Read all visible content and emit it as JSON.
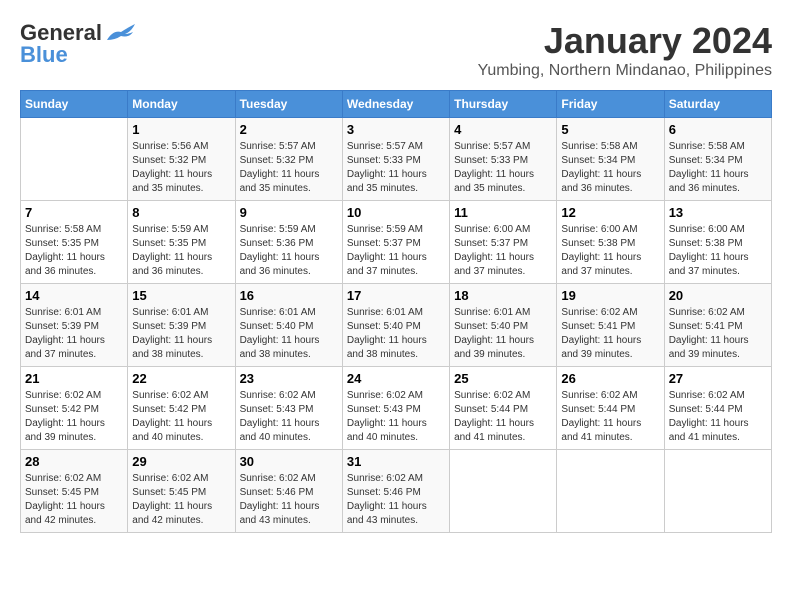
{
  "header": {
    "logo_line1": "General",
    "logo_line2": "Blue",
    "month": "January 2024",
    "location": "Yumbing, Northern Mindanao, Philippines"
  },
  "days_of_week": [
    "Sunday",
    "Monday",
    "Tuesday",
    "Wednesday",
    "Thursday",
    "Friday",
    "Saturday"
  ],
  "weeks": [
    [
      {
        "day": "",
        "sunrise": "",
        "sunset": "",
        "daylight": ""
      },
      {
        "day": "1",
        "sunrise": "Sunrise: 5:56 AM",
        "sunset": "Sunset: 5:32 PM",
        "daylight": "Daylight: 11 hours and 35 minutes."
      },
      {
        "day": "2",
        "sunrise": "Sunrise: 5:57 AM",
        "sunset": "Sunset: 5:32 PM",
        "daylight": "Daylight: 11 hours and 35 minutes."
      },
      {
        "day": "3",
        "sunrise": "Sunrise: 5:57 AM",
        "sunset": "Sunset: 5:33 PM",
        "daylight": "Daylight: 11 hours and 35 minutes."
      },
      {
        "day": "4",
        "sunrise": "Sunrise: 5:57 AM",
        "sunset": "Sunset: 5:33 PM",
        "daylight": "Daylight: 11 hours and 35 minutes."
      },
      {
        "day": "5",
        "sunrise": "Sunrise: 5:58 AM",
        "sunset": "Sunset: 5:34 PM",
        "daylight": "Daylight: 11 hours and 36 minutes."
      },
      {
        "day": "6",
        "sunrise": "Sunrise: 5:58 AM",
        "sunset": "Sunset: 5:34 PM",
        "daylight": "Daylight: 11 hours and 36 minutes."
      }
    ],
    [
      {
        "day": "7",
        "sunrise": "Sunrise: 5:58 AM",
        "sunset": "Sunset: 5:35 PM",
        "daylight": "Daylight: 11 hours and 36 minutes."
      },
      {
        "day": "8",
        "sunrise": "Sunrise: 5:59 AM",
        "sunset": "Sunset: 5:35 PM",
        "daylight": "Daylight: 11 hours and 36 minutes."
      },
      {
        "day": "9",
        "sunrise": "Sunrise: 5:59 AM",
        "sunset": "Sunset: 5:36 PM",
        "daylight": "Daylight: 11 hours and 36 minutes."
      },
      {
        "day": "10",
        "sunrise": "Sunrise: 5:59 AM",
        "sunset": "Sunset: 5:37 PM",
        "daylight": "Daylight: 11 hours and 37 minutes."
      },
      {
        "day": "11",
        "sunrise": "Sunrise: 6:00 AM",
        "sunset": "Sunset: 5:37 PM",
        "daylight": "Daylight: 11 hours and 37 minutes."
      },
      {
        "day": "12",
        "sunrise": "Sunrise: 6:00 AM",
        "sunset": "Sunset: 5:38 PM",
        "daylight": "Daylight: 11 hours and 37 minutes."
      },
      {
        "day": "13",
        "sunrise": "Sunrise: 6:00 AM",
        "sunset": "Sunset: 5:38 PM",
        "daylight": "Daylight: 11 hours and 37 minutes."
      }
    ],
    [
      {
        "day": "14",
        "sunrise": "Sunrise: 6:01 AM",
        "sunset": "Sunset: 5:39 PM",
        "daylight": "Daylight: 11 hours and 37 minutes."
      },
      {
        "day": "15",
        "sunrise": "Sunrise: 6:01 AM",
        "sunset": "Sunset: 5:39 PM",
        "daylight": "Daylight: 11 hours and 38 minutes."
      },
      {
        "day": "16",
        "sunrise": "Sunrise: 6:01 AM",
        "sunset": "Sunset: 5:40 PM",
        "daylight": "Daylight: 11 hours and 38 minutes."
      },
      {
        "day": "17",
        "sunrise": "Sunrise: 6:01 AM",
        "sunset": "Sunset: 5:40 PM",
        "daylight": "Daylight: 11 hours and 38 minutes."
      },
      {
        "day": "18",
        "sunrise": "Sunrise: 6:01 AM",
        "sunset": "Sunset: 5:40 PM",
        "daylight": "Daylight: 11 hours and 39 minutes."
      },
      {
        "day": "19",
        "sunrise": "Sunrise: 6:02 AM",
        "sunset": "Sunset: 5:41 PM",
        "daylight": "Daylight: 11 hours and 39 minutes."
      },
      {
        "day": "20",
        "sunrise": "Sunrise: 6:02 AM",
        "sunset": "Sunset: 5:41 PM",
        "daylight": "Daylight: 11 hours and 39 minutes."
      }
    ],
    [
      {
        "day": "21",
        "sunrise": "Sunrise: 6:02 AM",
        "sunset": "Sunset: 5:42 PM",
        "daylight": "Daylight: 11 hours and 39 minutes."
      },
      {
        "day": "22",
        "sunrise": "Sunrise: 6:02 AM",
        "sunset": "Sunset: 5:42 PM",
        "daylight": "Daylight: 11 hours and 40 minutes."
      },
      {
        "day": "23",
        "sunrise": "Sunrise: 6:02 AM",
        "sunset": "Sunset: 5:43 PM",
        "daylight": "Daylight: 11 hours and 40 minutes."
      },
      {
        "day": "24",
        "sunrise": "Sunrise: 6:02 AM",
        "sunset": "Sunset: 5:43 PM",
        "daylight": "Daylight: 11 hours and 40 minutes."
      },
      {
        "day": "25",
        "sunrise": "Sunrise: 6:02 AM",
        "sunset": "Sunset: 5:44 PM",
        "daylight": "Daylight: 11 hours and 41 minutes."
      },
      {
        "day": "26",
        "sunrise": "Sunrise: 6:02 AM",
        "sunset": "Sunset: 5:44 PM",
        "daylight": "Daylight: 11 hours and 41 minutes."
      },
      {
        "day": "27",
        "sunrise": "Sunrise: 6:02 AM",
        "sunset": "Sunset: 5:44 PM",
        "daylight": "Daylight: 11 hours and 41 minutes."
      }
    ],
    [
      {
        "day": "28",
        "sunrise": "Sunrise: 6:02 AM",
        "sunset": "Sunset: 5:45 PM",
        "daylight": "Daylight: 11 hours and 42 minutes."
      },
      {
        "day": "29",
        "sunrise": "Sunrise: 6:02 AM",
        "sunset": "Sunset: 5:45 PM",
        "daylight": "Daylight: 11 hours and 42 minutes."
      },
      {
        "day": "30",
        "sunrise": "Sunrise: 6:02 AM",
        "sunset": "Sunset: 5:46 PM",
        "daylight": "Daylight: 11 hours and 43 minutes."
      },
      {
        "day": "31",
        "sunrise": "Sunrise: 6:02 AM",
        "sunset": "Sunset: 5:46 PM",
        "daylight": "Daylight: 11 hours and 43 minutes."
      },
      {
        "day": "",
        "sunrise": "",
        "sunset": "",
        "daylight": ""
      },
      {
        "day": "",
        "sunrise": "",
        "sunset": "",
        "daylight": ""
      },
      {
        "day": "",
        "sunrise": "",
        "sunset": "",
        "daylight": ""
      }
    ]
  ]
}
